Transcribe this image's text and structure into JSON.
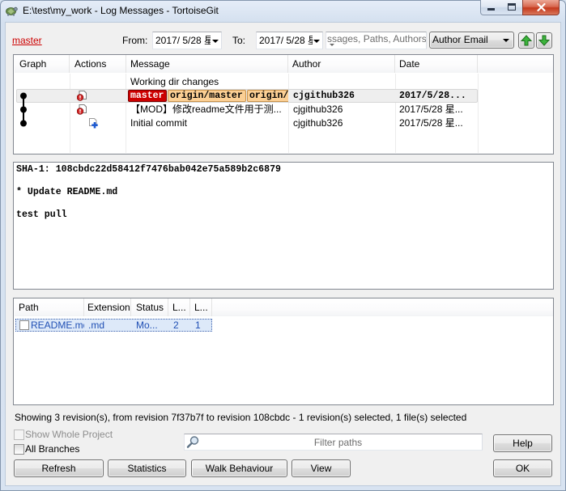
{
  "window": {
    "title": "E:\\test\\my_work - Log Messages - TortoiseGit",
    "icons": {
      "app": "tortoisegit-icon",
      "minimize": "minimize-icon",
      "maximize": "maximize-icon",
      "close": "close-icon"
    }
  },
  "toolbar": {
    "branch": "master",
    "from_label": "From:",
    "from_date": "2017/ 5/28 星",
    "to_label": "To:",
    "to_date": "2017/ 5/28 星",
    "search_placeholder": "ssages, Paths, Authors, E",
    "filter_field": "Author Email",
    "icons": {
      "search": "search-dropdown-icon",
      "up": "arrow-up-icon",
      "down": "arrow-down-icon"
    }
  },
  "log": {
    "columns": {
      "graph": "Graph",
      "actions": "Actions",
      "message": "Message",
      "author": "Author",
      "date": "Date"
    },
    "rows": [
      {
        "message": "Working dir changes",
        "selected": false
      },
      {
        "refs": [
          "master",
          "origin/master",
          "origin/"
        ],
        "author": "cjgithub326",
        "date": "2017/5/28...",
        "action_icon": "modified-icon",
        "selected": true
      },
      {
        "message": "【MOD】修改readme文件用于测...",
        "author": "cjgithub326",
        "date": "2017/5/28 星...",
        "action_icon": "modified-icon",
        "selected": false
      },
      {
        "message": "Initial commit",
        "author": "cjgithub326",
        "date": "2017/5/28 星...",
        "action_icon": "added-icon",
        "selected": false
      }
    ]
  },
  "detail": {
    "sha": "SHA-1: 108cbdc22d58412f7476bab042e75a589b2c6879",
    "subject": "* Update README.md",
    "body": "test pull"
  },
  "files": {
    "columns": {
      "path": "Path",
      "extension": "Extension",
      "status": "Status",
      "col4": "L...",
      "col5": "L..."
    },
    "rows": [
      {
        "path": "README.md",
        "extension": ".md",
        "status": "Mo...",
        "col4": "2",
        "col5": "1",
        "selected": true
      }
    ]
  },
  "status_text": "Showing 3 revision(s), from revision 7f37b7f to revision 108cbdc - 1 revision(s) selected, 1 file(s) selected",
  "options": {
    "show_whole_project": {
      "label": "Show Whole Project",
      "checked": false,
      "enabled": false
    },
    "all_branches": {
      "label": "All Branches",
      "checked": false,
      "enabled": true
    }
  },
  "filter": {
    "placeholder": "Filter paths",
    "icon": "search-icon"
  },
  "buttons": {
    "help": "Help",
    "refresh": "Refresh",
    "statistics": "Statistics",
    "walk_behaviour": "Walk Behaviour",
    "view": "View",
    "ok": "OK"
  },
  "colors": {
    "branch_link": "#cc0000",
    "ref_local": "#cc0000",
    "ref_remote": "#fbcf94",
    "modified_file_text": "#1f4fb4",
    "close_button": "#c4391d"
  }
}
